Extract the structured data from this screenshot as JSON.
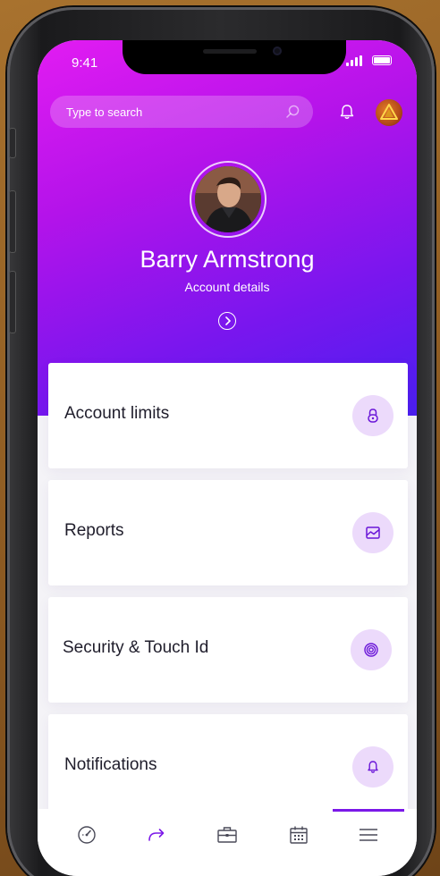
{
  "status_bar": {
    "time": "9:41"
  },
  "search": {
    "placeholder": "Type to search"
  },
  "profile": {
    "name": "Barry Armstrong",
    "subtitle": "Account details"
  },
  "menu": {
    "items": [
      {
        "label": "Account limits",
        "icon": "lock-icon"
      },
      {
        "label": "Reports",
        "icon": "chart-icon"
      },
      {
        "label": "Security & Touch Id",
        "icon": "fingerprint-icon"
      },
      {
        "label": "Notifications",
        "icon": "bell-icon"
      }
    ]
  },
  "tabbar": {
    "tabs": [
      {
        "icon": "speedometer-icon"
      },
      {
        "icon": "transfer-arrow-icon"
      },
      {
        "icon": "briefcase-icon"
      },
      {
        "icon": "calendar-icon"
      },
      {
        "icon": "menu-icon",
        "active": true
      }
    ]
  },
  "colors": {
    "gradient_start": "#e21cf2",
    "gradient_end": "#4a1ff0",
    "accent": "#7b18e8",
    "icon_bg": "#ecdafb"
  }
}
